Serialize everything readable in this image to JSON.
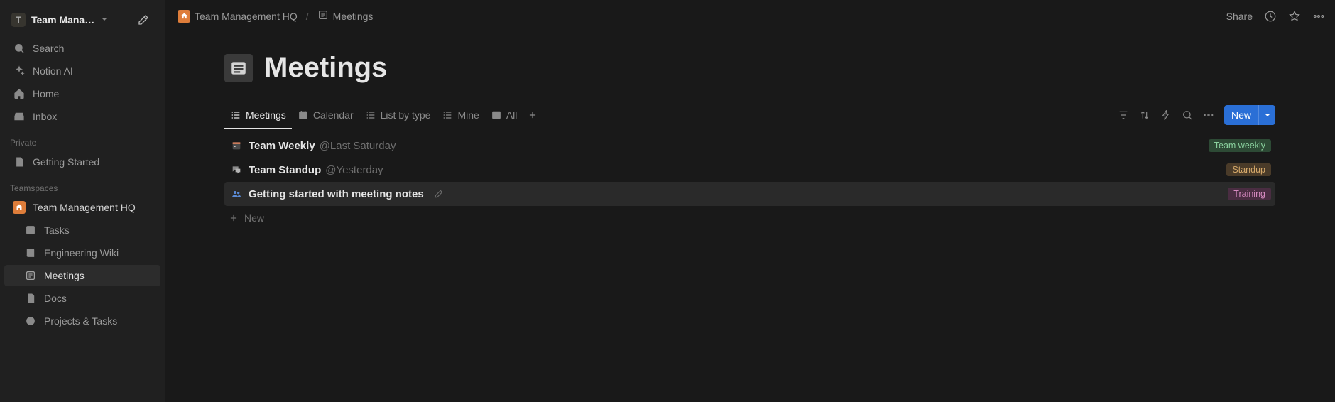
{
  "workspace": {
    "badge": "T",
    "name": "Team Mana…"
  },
  "sidebar": {
    "search": "Search",
    "ai": "Notion AI",
    "home": "Home",
    "inbox": "Inbox",
    "private_label": "Private",
    "private_items": [
      "Getting Started"
    ],
    "teamspaces_label": "Teamspaces",
    "teamspace_name": "Team Management HQ",
    "team_pages": [
      "Tasks",
      "Engineering Wiki",
      "Meetings",
      "Docs",
      "Projects & Tasks"
    ]
  },
  "breadcrumb": {
    "root": "Team Management HQ",
    "page": "Meetings"
  },
  "topbar": {
    "share": "Share"
  },
  "page": {
    "title": "Meetings",
    "tabs": [
      "Meetings",
      "Calendar",
      "List by type",
      "Mine",
      "All"
    ],
    "new_button": "New",
    "rows": [
      {
        "icon": "calendar",
        "title": "Team Weekly",
        "date": "@Last Saturday",
        "tag": "Team weekly",
        "tagColor": "green"
      },
      {
        "icon": "chat",
        "title": "Team Standup",
        "date": "@Yesterday",
        "tag": "Standup",
        "tagColor": "brown"
      },
      {
        "icon": "people",
        "title": "Getting started with meeting notes",
        "date": "",
        "tag": "Training",
        "tagColor": "pink",
        "hover": true
      }
    ],
    "new_row": "New"
  }
}
